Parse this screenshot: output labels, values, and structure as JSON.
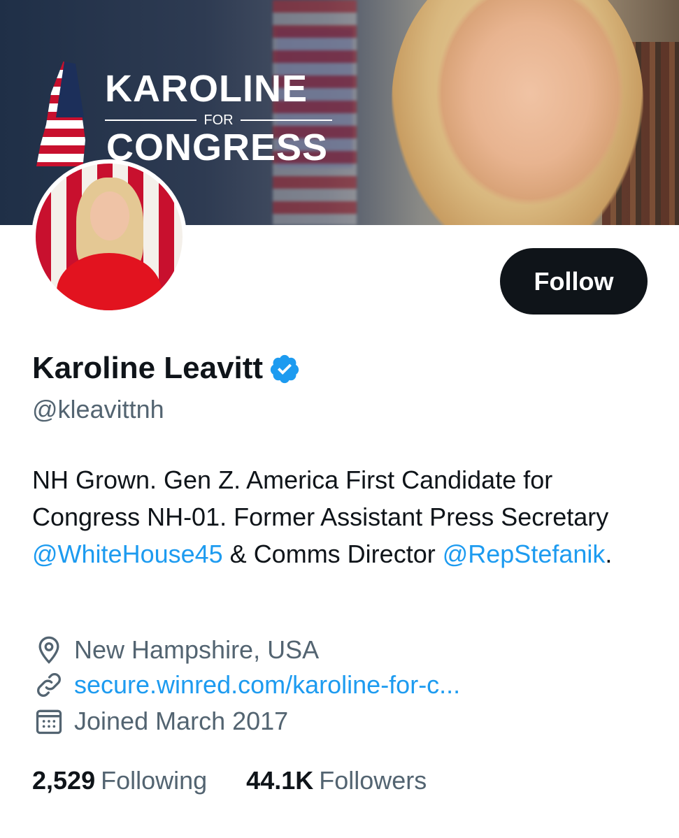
{
  "banner": {
    "logo_line1": "KAROLINE",
    "logo_for": "FOR",
    "logo_line2": "CONGRESS"
  },
  "profile": {
    "display_name": "Karoline Leavitt",
    "handle": "@kleavittnh",
    "verified": true,
    "follow_label": "Follow",
    "bio": {
      "part1": "NH Grown. Gen Z. America First Candidate for Congress NH-01. Former Assistant Press Secretary ",
      "mention1": "@WhiteHouse45",
      "part2": " & Comms Director ",
      "mention2": "@RepStefanik",
      "part3": "."
    },
    "location": "New Hampshire, USA",
    "website": "secure.winred.com/karoline-for-c...",
    "joined": "Joined March 2017"
  },
  "stats": {
    "following_count": "2,529",
    "following_label": "Following",
    "followers_count": "44.1K",
    "followers_label": "Followers"
  },
  "colors": {
    "accent": "#1d9bf0",
    "text_primary": "#0f1419",
    "text_secondary": "#536471",
    "button_bg": "#0f1419"
  },
  "icons": [
    "verified-badge-icon",
    "location-pin-icon",
    "link-icon",
    "calendar-icon"
  ]
}
